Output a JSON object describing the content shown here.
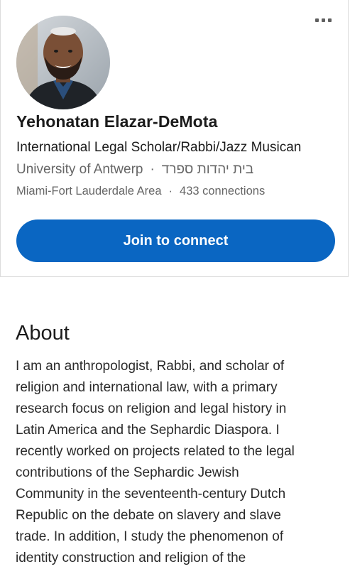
{
  "profile": {
    "name": "Yehonatan Elazar-DeMota",
    "headline": "International Legal Scholar/Rabbi/Jazz Musican",
    "education": "University of Antwerp",
    "organization": "בית יהדות ספרד",
    "separator": "·",
    "location": "Miami-Fort Lauderdale Area",
    "connections": "433 connections",
    "avatar_icon": "profile-photo"
  },
  "actions": {
    "more_icon": "more-options-icon",
    "join_label": "Join to connect"
  },
  "about": {
    "title": "About",
    "lines": [
      "I am an anthropologist, Rabbi, and scholar of",
      "religion and international law, with a primary",
      "research focus on religion and legal history in",
      "Latin America and the Sephardic Diaspora. I",
      "recently worked on projects related to the legal",
      "contributions of the Sephardic Jewish",
      "Community in the seventeenth-century Dutch",
      "Republic on the debate on slavery and slave",
      "trade. In addition, I study the phenomenon of",
      "identity construction and religion of the"
    ]
  },
  "colors": {
    "brand_blue": "#0a66c2",
    "secondary_text": "#666666"
  }
}
